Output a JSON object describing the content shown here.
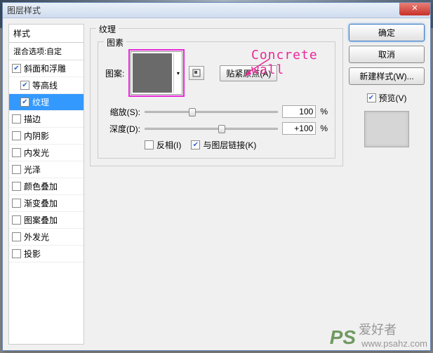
{
  "dialog": {
    "title": "图层样式"
  },
  "styles": {
    "header": "样式",
    "blending": "混合选项:自定",
    "items": [
      {
        "label": "斜面和浮雕",
        "checked": true,
        "selected": false,
        "indent": false
      },
      {
        "label": "等高线",
        "checked": true,
        "selected": false,
        "indent": true
      },
      {
        "label": "纹理",
        "checked": true,
        "selected": true,
        "indent": true
      },
      {
        "label": "描边",
        "checked": false,
        "selected": false,
        "indent": false
      },
      {
        "label": "内阴影",
        "checked": false,
        "selected": false,
        "indent": false
      },
      {
        "label": "内发光",
        "checked": false,
        "selected": false,
        "indent": false
      },
      {
        "label": "光泽",
        "checked": false,
        "selected": false,
        "indent": false
      },
      {
        "label": "颜色叠加",
        "checked": false,
        "selected": false,
        "indent": false
      },
      {
        "label": "渐变叠加",
        "checked": false,
        "selected": false,
        "indent": false
      },
      {
        "label": "图案叠加",
        "checked": false,
        "selected": false,
        "indent": false
      },
      {
        "label": "外发光",
        "checked": false,
        "selected": false,
        "indent": false
      },
      {
        "label": "投影",
        "checked": false,
        "selected": false,
        "indent": false
      }
    ]
  },
  "texture": {
    "group_title": "纹理",
    "elements_title": "图素",
    "pattern_label": "图案:",
    "snap_origin": "贴紧原点(A)",
    "scale_label": "缩放(S):",
    "scale_value": "100",
    "scale_unit": "%",
    "depth_label": "深度(D):",
    "depth_value": "+100",
    "depth_unit": "%",
    "invert_label": "反相(I)",
    "link_label": "与图层链接(K)"
  },
  "buttons": {
    "ok": "确定",
    "cancel": "取消",
    "new_style": "新建样式(W)...",
    "preview": "预览(V)"
  },
  "annotation": {
    "text": "Concrete wall"
  },
  "watermark": {
    "logo": "PS",
    "name": "爱好者",
    "url": "www.psahz.com"
  }
}
